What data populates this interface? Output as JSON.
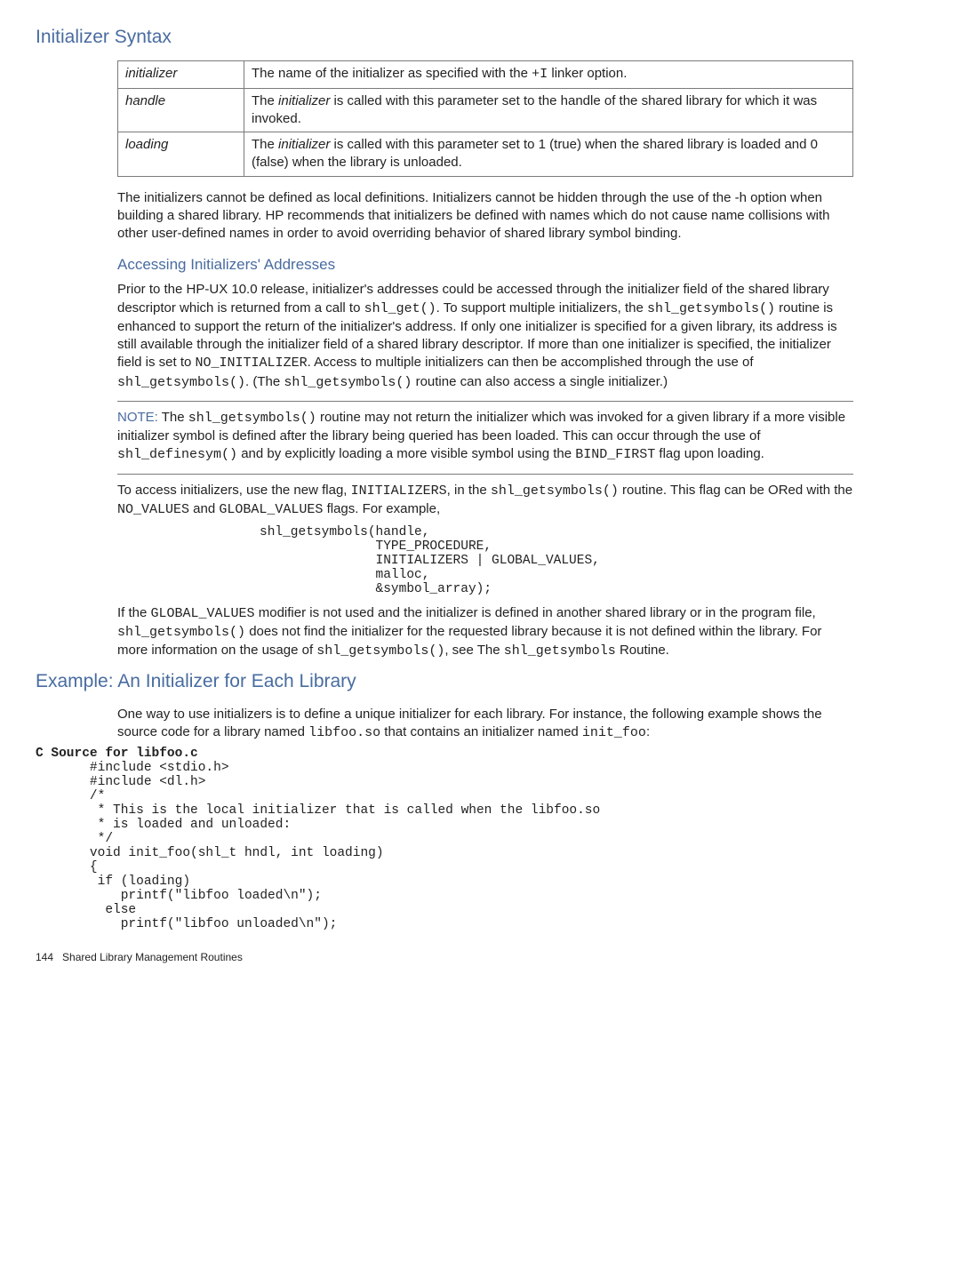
{
  "headings": {
    "h2a": "Initializer Syntax",
    "h3a": "Accessing Initializers' Addresses",
    "h2b": "Example: An Initializer for Each Library"
  },
  "table": {
    "r1k": "initializer",
    "r1v_pre": "The name of the initializer as specified with the ",
    "r1v_code": "+I",
    "r1v_post": " linker option.",
    "r2k": "handle",
    "r2v_pre": "The ",
    "r2v_em": "initializer",
    "r2v_post": " is called with this parameter set to the handle of the shared library for which it was invoked.",
    "r3k": "loading",
    "r3v_pre": "The ",
    "r3v_em": "initializer",
    "r3v_post": " is called with this parameter set to 1 (true) when the shared library is loaded and 0 (false) when the library is unloaded."
  },
  "p1": "The initializers cannot be defined as local definitions. Initializers cannot be hidden through the use of the -h option when building a shared library. HP recommends that initializers be defined with names which do not cause name collisions with other user-defined names in order to avoid overriding behavior of shared library symbol binding.",
  "p2": {
    "t1": "Prior to the HP-UX 10.0 release, initializer's addresses could be accessed through the initializer field of the shared library descriptor which is returned from a call to ",
    "c1": "shl_get()",
    "t2": ". To support multiple initializers, the ",
    "c2": "shl_getsymbols()",
    "t3": " routine is enhanced to support the return of the initializer's address. If only one initializer is specified for a given library, its address is still available through the initializer field of a shared library descriptor. If more than one initializer is specified, the initializer field is set to ",
    "c3": "NO_INITIALIZER",
    "t4": ". Access to multiple initializers can then be accomplished through the use of ",
    "c4": "shl_getsymbols()",
    "t5": ". (The ",
    "c5": "shl_getsymbols()",
    "t6": " routine can also access a single initializer.)"
  },
  "note": {
    "lead": "NOTE:",
    "t1": "   The ",
    "c1": "shl_getsymbols()",
    "t2": " routine may not return the initializer which was invoked for a given library if a more visible initializer symbol is defined after the library being queried has been loaded. This can occur through the use of ",
    "c2": "shl_definesym()",
    "t3": " and by explicitly loading a more visible symbol using the ",
    "c3": "BIND_FIRST",
    "t4": " flag upon loading."
  },
  "p3": {
    "t1": "To access initializers, use the new flag, ",
    "c1": "INITIALIZERS",
    "t2": ", in the ",
    "c2": "shl_getsymbols()",
    "t3": " routine. This flag can be ORed with the ",
    "c3": "NO_VALUES",
    "t4": " and ",
    "c4": "GLOBAL_VALUES",
    "t5": " flags. For example,"
  },
  "code1": "shl_getsymbols(handle,\n               TYPE_PROCEDURE,\n               INITIALIZERS | GLOBAL_VALUES,\n               malloc,\n               &symbol_array);",
  "p4": {
    "t1": "If the ",
    "c1": "GLOBAL_VALUES",
    "t2": " modifier is not used and the initializer is defined in another shared library or in the program file, ",
    "c2": "shl_getsymbols()",
    "t3": " does not find the initializer for the requested library because it is not defined within the library. For more information on the usage of ",
    "c3": "shl_getsymbols()",
    "t4": ", see The ",
    "c4": "shl_getsymbols",
    "t5": " Routine."
  },
  "p5": {
    "t1": "One way to use initializers is to define a unique initializer for each library. For instance, the following example shows the source code for a library named ",
    "c1": "libfoo.so",
    "t2": " that contains an initializer named ",
    "c2": "init_foo",
    "t3": ":"
  },
  "code2_head": "C Source for libfoo.c",
  "code2": "       #include <stdio.h>\n       #include <dl.h>\n       /*\n        * This is the local initializer that is called when the libfoo.so\n        * is loaded and unloaded:\n        */\n       void init_foo(shl_t hndl, int loading)\n       {\n        if (loading)\n           printf(\"libfoo loaded\\n\");\n         else\n           printf(\"libfoo unloaded\\n\");",
  "footer": {
    "page": "144",
    "title": "Shared Library Management Routines"
  }
}
